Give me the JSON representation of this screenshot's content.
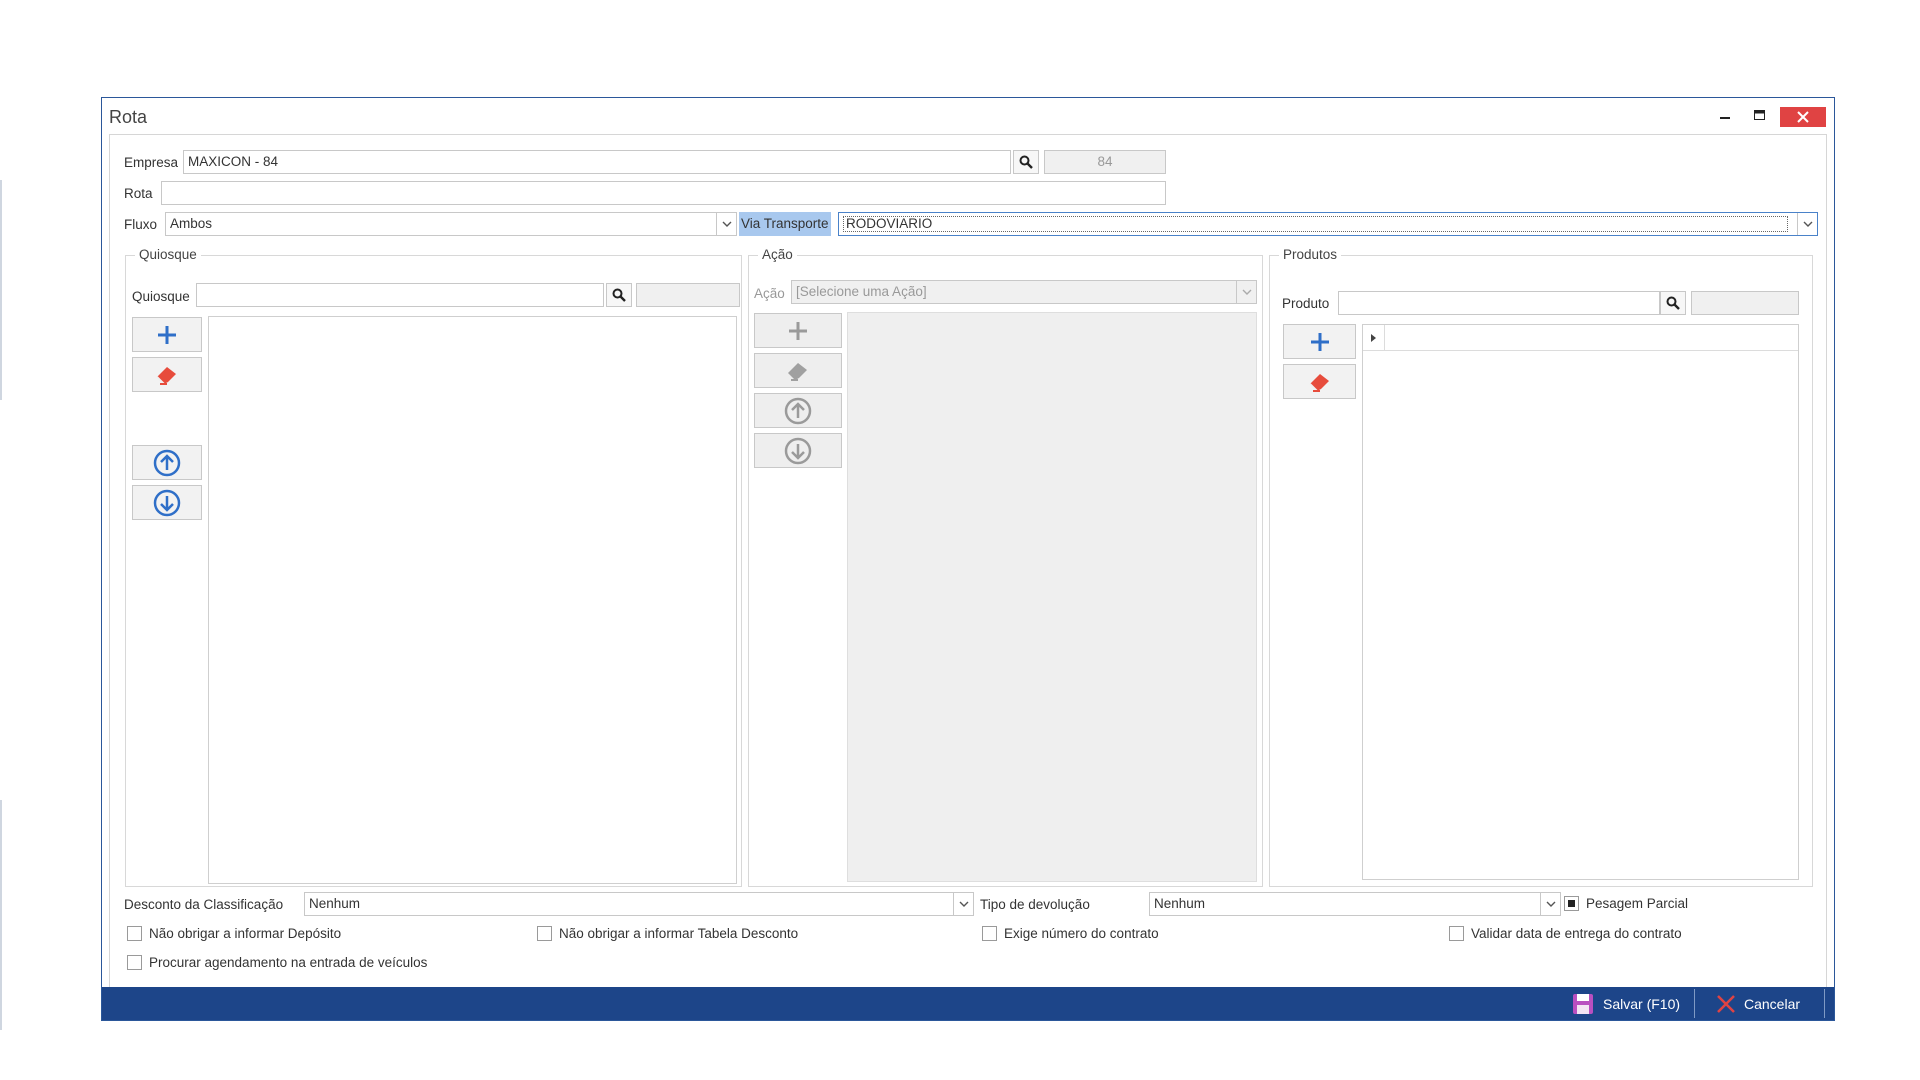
{
  "window": {
    "title": "Rota"
  },
  "form": {
    "empresa": {
      "label": "Empresa",
      "value": "MAXICON - 84",
      "code": "84"
    },
    "rota": {
      "label": "Rota",
      "value": ""
    },
    "fluxo": {
      "label": "Fluxo",
      "value": "Ambos"
    },
    "via_transporte": {
      "label": "Via Transporte",
      "value": "RODOVIARIO"
    }
  },
  "quiosque": {
    "title": "Quiosque",
    "field_label": "Quiosque",
    "value": ""
  },
  "acao": {
    "title": "Ação",
    "field_label": "Ação",
    "placeholder": "[Selecione uma Ação]"
  },
  "produtos": {
    "title": "Produtos",
    "field_label": "Produto",
    "value": ""
  },
  "bottom": {
    "desconto": {
      "label": "Desconto da Classificação",
      "value": "Nenhum"
    },
    "devolucao": {
      "label": "Tipo de devolução",
      "value": "Nenhum"
    },
    "pesagem": {
      "label": "Pesagem Parcial",
      "checked": true
    },
    "checks": [
      {
        "label": "Não obrigar a informar Depósito"
      },
      {
        "label": "Não obrigar a informar Tabela Desconto"
      },
      {
        "label": "Exige número do contrato"
      },
      {
        "label": "Validar data de entrega do contrato"
      },
      {
        "label": "Procurar agendamento na entrada de veículos"
      }
    ]
  },
  "footer": {
    "save_label": "Salvar (F10)",
    "cancel_label": "Cancelar"
  },
  "colors": {
    "accent": "#2b579a",
    "footer": "#1d4589",
    "close": "#e04343",
    "add_icon": "#2f6fc8",
    "eraser": "#e74c3c",
    "highlight": "#a8c8ee"
  },
  "icons": [
    "search-icon",
    "chevron-down-icon",
    "plus-icon",
    "eraser-icon",
    "arrow-up-circle-icon",
    "arrow-down-circle-icon",
    "save-icon",
    "close-icon",
    "minimize-icon",
    "maximize-icon"
  ]
}
